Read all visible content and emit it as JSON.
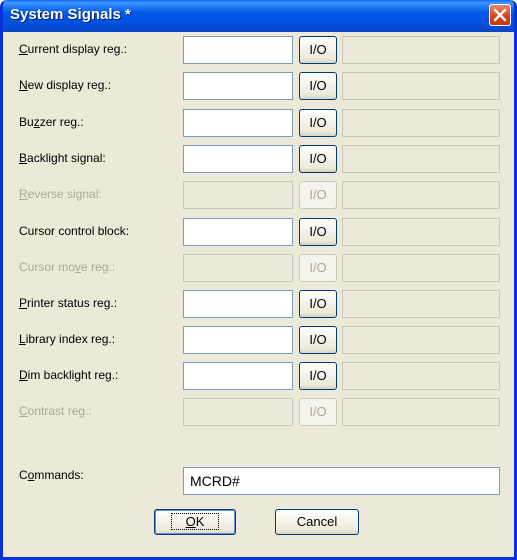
{
  "window": {
    "title": "System Signals *"
  },
  "io_label": "I/O",
  "rows": [
    {
      "pre": "",
      "u": "C",
      "post": "urrent display reg.:",
      "enabled": true
    },
    {
      "pre": "",
      "u": "N",
      "post": "ew display reg.:",
      "enabled": true
    },
    {
      "pre": "Bu",
      "u": "z",
      "post": "zer reg.:",
      "enabled": true
    },
    {
      "pre": "",
      "u": "B",
      "post": "acklight signal:",
      "enabled": true
    },
    {
      "pre": "",
      "u": "R",
      "post": "everse signal:",
      "enabled": false
    },
    {
      "pre": "Cursor control block:",
      "u": "",
      "post": "",
      "enabled": true
    },
    {
      "pre": "Cursor mo",
      "u": "v",
      "post": "e reg.:",
      "enabled": false
    },
    {
      "pre": "",
      "u": "P",
      "post": "rinter status reg.:",
      "enabled": true
    },
    {
      "pre": "",
      "u": "L",
      "post": "ibrary index reg.:",
      "enabled": true
    },
    {
      "pre": "",
      "u": "D",
      "post": "im backlight reg.:",
      "enabled": true
    },
    {
      "pre": "",
      "u": "C",
      "post": "ontrast reg.:",
      "enabled": false
    }
  ],
  "commands": {
    "pre": "C",
    "u": "o",
    "post": "mmands:",
    "value": "MCRD#"
  },
  "buttons": {
    "ok_u": "O",
    "ok_rest": "K",
    "cancel": "Cancel"
  },
  "colors": {
    "title_bar": "#0058e6",
    "dialog_bg": "#ece9d8",
    "close_button": "#d7401c"
  }
}
